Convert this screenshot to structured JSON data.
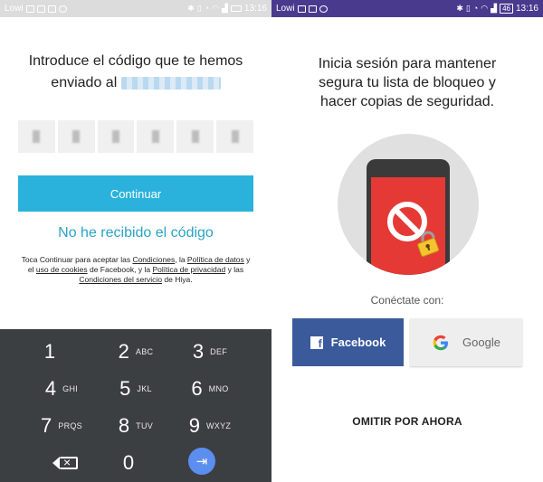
{
  "left": {
    "statusbar": {
      "carrier": "Lowi",
      "time": "13:16"
    },
    "title_line1": "Introduce el código que te hemos",
    "title_line2_prefix": "enviado al",
    "code_digits": [
      "",
      "",
      "",
      "",
      "",
      ""
    ],
    "continue_label": "Continuar",
    "no_code_label": "No he recibido el código",
    "terms": {
      "t1": "Toca Continuar para aceptar las ",
      "l1": "Condiciones",
      "t2": ", la ",
      "l2": "Política de datos",
      "t3": " y el ",
      "l3": "uso de cookies",
      "t4": " de Facebook, y la ",
      "l4": "Política de privacidad",
      "t5": " y las ",
      "l5": "Condiciones del servicio",
      "t6": " de Hiya."
    },
    "keypad": {
      "k1": {
        "num": "1",
        "letters": ""
      },
      "k2": {
        "num": "2",
        "letters": "ABC"
      },
      "k3": {
        "num": "3",
        "letters": "DEF"
      },
      "k4": {
        "num": "4",
        "letters": "GHI"
      },
      "k5": {
        "num": "5",
        "letters": "JKL"
      },
      "k6": {
        "num": "6",
        "letters": "MNO"
      },
      "k7": {
        "num": "7",
        "letters": "PRQS"
      },
      "k8": {
        "num": "8",
        "letters": "TUV"
      },
      "k9": {
        "num": "9",
        "letters": "WXYZ"
      },
      "k0": {
        "num": "0",
        "letters": ""
      },
      "backspace_icon": "backspace-icon",
      "enter_icon": "enter-icon"
    }
  },
  "right": {
    "statusbar": {
      "carrier": "Lowi",
      "time": "13:16",
      "battery": "46"
    },
    "title_line1": "Inicia sesión para mantener",
    "title_line2": "segura tu lista de bloqueo y",
    "title_line3": "hacer copias de seguridad.",
    "connect_label": "Conéctate con:",
    "facebook_label": "Facebook",
    "google_label": "Google",
    "skip_label": "OMITIR POR AHORA"
  },
  "colors": {
    "continue_button": "#2ab2dc",
    "link_text": "#2aa4c4",
    "keypad_bg": "#3c3f41",
    "facebook_blue": "#3b5a9c",
    "statusbar_right": "#4a3a8e",
    "phone_screen_red": "#e53935"
  }
}
